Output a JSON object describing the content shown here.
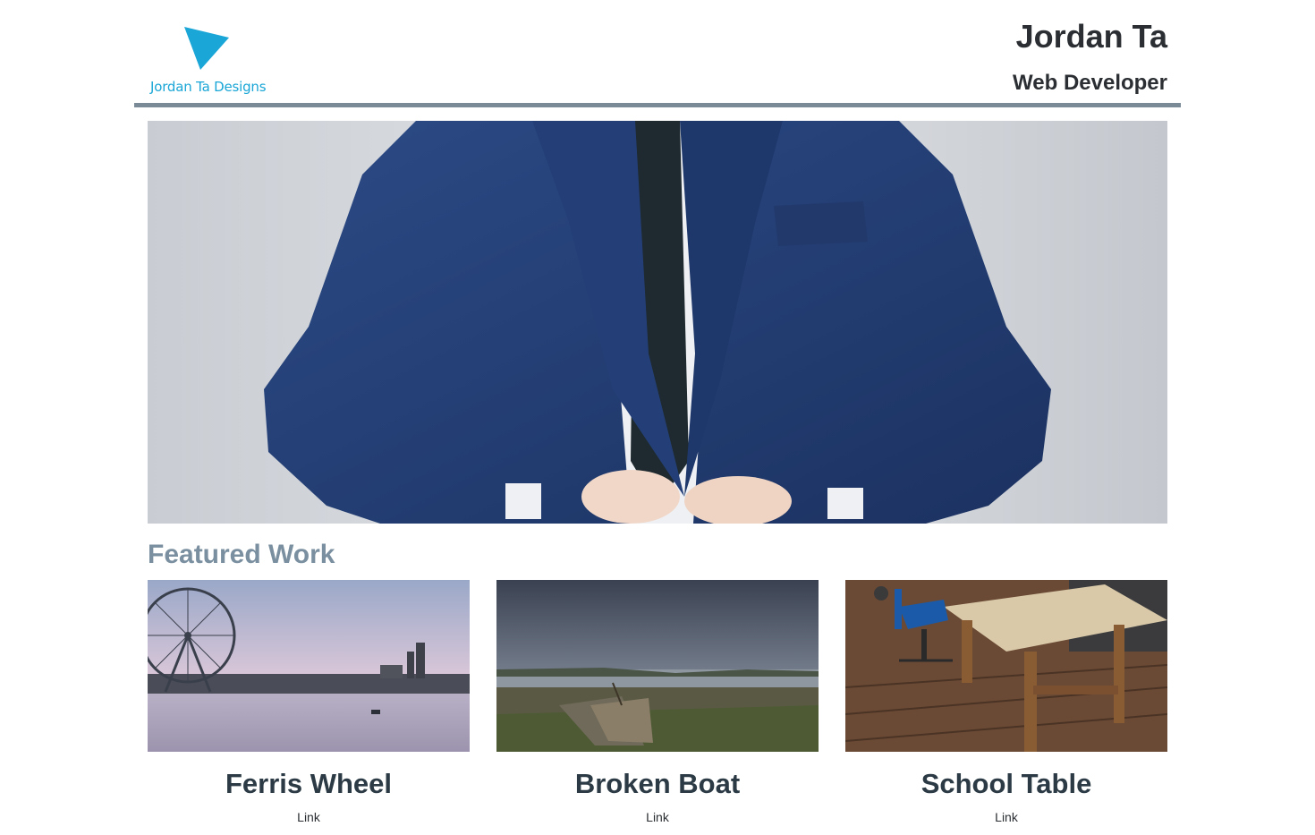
{
  "header": {
    "logo_text": "Jordan Ta Designs",
    "name": "Jordan Ta",
    "role": "Web Developer"
  },
  "colors": {
    "accent": "#1aa6d6",
    "rule": "#7a8a96",
    "section_title": "#7a8fa0"
  },
  "hero": {
    "subject": "man-in-blue-suit"
  },
  "featured": {
    "title": "Featured Work",
    "items": [
      {
        "title": "Ferris Wheel",
        "link": "Link"
      },
      {
        "title": "Broken Boat",
        "link": "Link"
      },
      {
        "title": "School Table",
        "link": "Link"
      }
    ]
  }
}
